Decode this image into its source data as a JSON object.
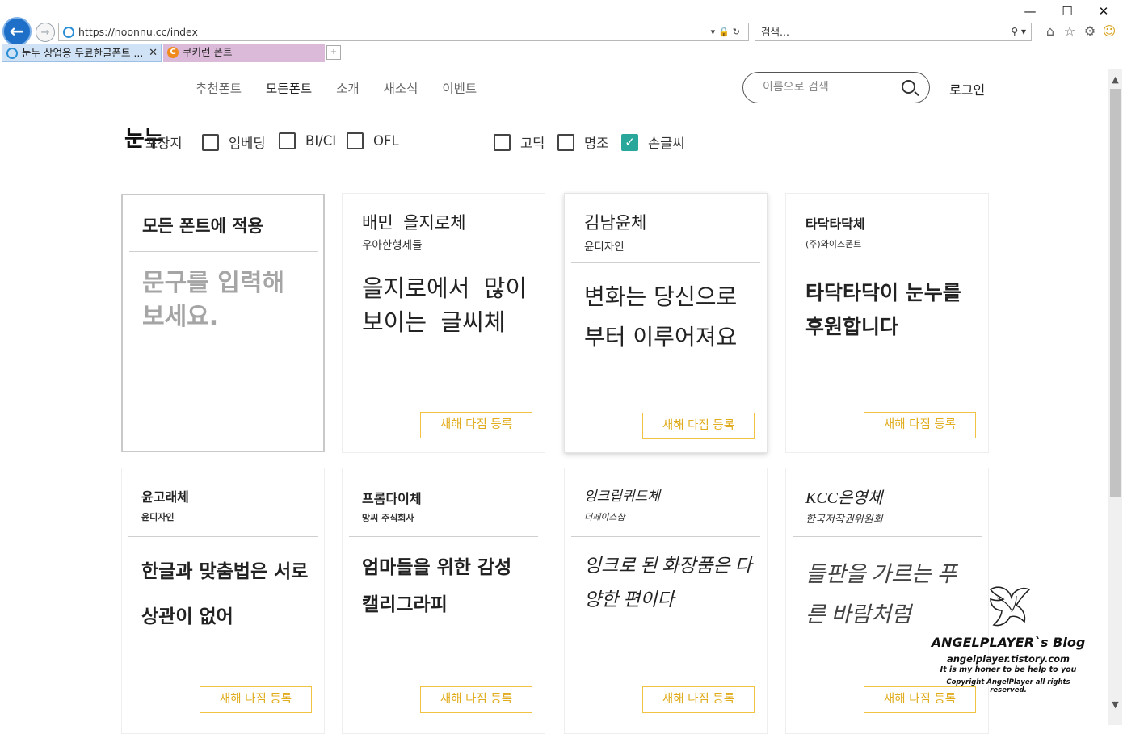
{
  "browser": {
    "url": "https://noonnu.cc/index",
    "search_placeholder": "검색...",
    "tabs": [
      {
        "label": "눈누 상업용 무료한글폰트 ..."
      },
      {
        "label": "쿠키런 폰트"
      }
    ]
  },
  "header": {
    "nav": [
      "추천폰트",
      "모든폰트",
      "소개",
      "새소식",
      "이벤트"
    ],
    "search_placeholder": "이름으로 검색",
    "login": "로그인"
  },
  "logo": "눈누",
  "filters": {
    "license": [
      "포장지",
      "임베딩",
      "BI/CI",
      "OFL"
    ],
    "style": [
      {
        "label": "고딕",
        "checked": false
      },
      {
        "label": "명조",
        "checked": false
      },
      {
        "label": "손글씨",
        "checked": true
      }
    ]
  },
  "apply_card": {
    "title": "모든 폰트에 적용",
    "placeholder": "문구를 입력해 보세요."
  },
  "cta_label": "새해 다짐 등록",
  "fonts": [
    {
      "name": "배민 을지로체",
      "maker": "우아한형제들",
      "sample": "을지로에서 많이 보이는 글씨체"
    },
    {
      "name": "김남윤체",
      "maker": "윤디자인",
      "sample": "변화는 당신으로부터 이루어져요"
    },
    {
      "name": "타닥타닥체",
      "maker": "(주)와이즈폰트",
      "sample": "타닥타닥이 눈누를 후원합니다"
    },
    {
      "name": "윤고래체",
      "maker": "윤디자인",
      "sample": "한글과 맞춤법은 서로 상관이 없어"
    },
    {
      "name": "프롬다이체",
      "maker": "망씨 주식회사",
      "sample": "엄마들을 위한 감성 캘리그라피"
    },
    {
      "name": "잉크립퀴드체",
      "maker": "더페이스샵",
      "sample": "잉크로 된 화장품은 다양한 편이다"
    },
    {
      "name": "KCC은영체",
      "maker": "한국저작권위원회",
      "sample": "들판을 가르는 푸른 바람처럼"
    }
  ],
  "watermark": {
    "title": "ANGELPLAYER`s Blog",
    "url": "angelplayer.tistory.com",
    "line": "It is my honer to be help to you",
    "copyright": "Copyright AngelPlayer all rights reserved."
  }
}
